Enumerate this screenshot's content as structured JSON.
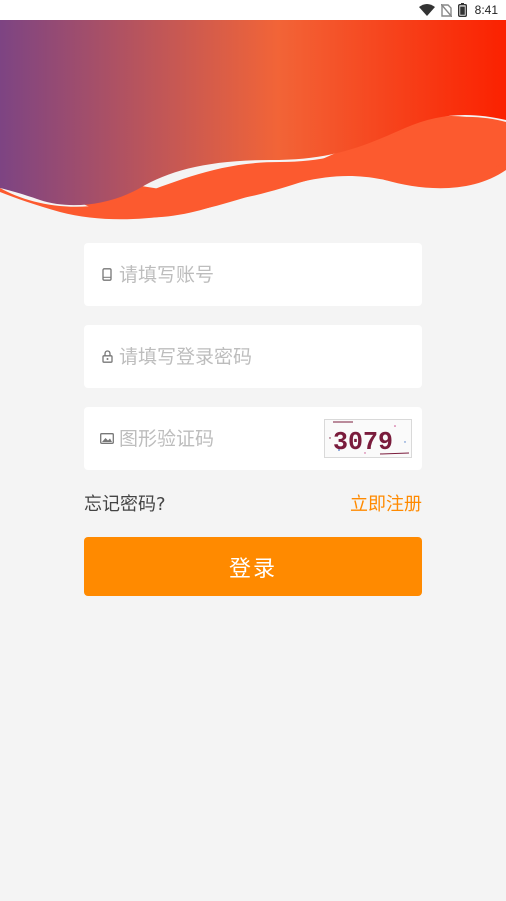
{
  "status_bar": {
    "time": "8:41",
    "icons": [
      "wifi-icon",
      "no-sim-icon",
      "battery-icon"
    ]
  },
  "header": {
    "gradient_colors": [
      "#7d4483",
      "#f26437",
      "#fb2100"
    ],
    "wave_color": "#fc5a2f"
  },
  "form": {
    "account": {
      "icon": "phone-icon",
      "placeholder": "请填写账号",
      "value": ""
    },
    "password": {
      "icon": "lock-icon",
      "placeholder": "请填写登录密码",
      "value": ""
    },
    "captcha": {
      "icon": "image-icon",
      "placeholder": "图形验证码",
      "value": "",
      "captcha_text": "3079",
      "captcha_color": "#7a1c3c"
    }
  },
  "links": {
    "forgot_password": "忘记密码?",
    "register": "立即注册"
  },
  "login_button": {
    "label": "登录",
    "color": "#ff8a00"
  }
}
